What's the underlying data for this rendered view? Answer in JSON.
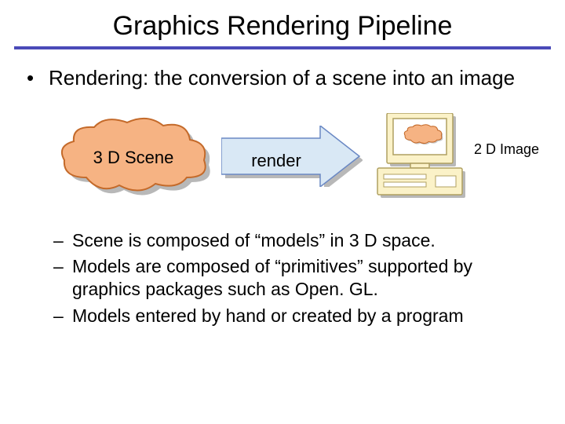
{
  "title": "Graphics Rendering Pipeline",
  "main_bullet": "Rendering: the conversion of a scene into an image",
  "diagram": {
    "cloud_label": "3 D Scene",
    "arrow_label": "render",
    "image_label": "2 D Image"
  },
  "sub_bullets": [
    "Scene is composed of “models” in 3 D space.",
    "Models are composed of “primitives” supported by graphics packages such as Open. GL.",
    "Models entered by hand or created by a program"
  ],
  "colors": {
    "rule": "#4a4ab8",
    "cloud_fill": "#f6b383",
    "cloud_stroke": "#c46a2a",
    "shadow": "#b8b8b8",
    "arrow_fill": "#d9e8f5",
    "arrow_stroke": "#6a88c4",
    "computer_body": "#fbf2c8",
    "computer_stroke": "#b0a060"
  }
}
